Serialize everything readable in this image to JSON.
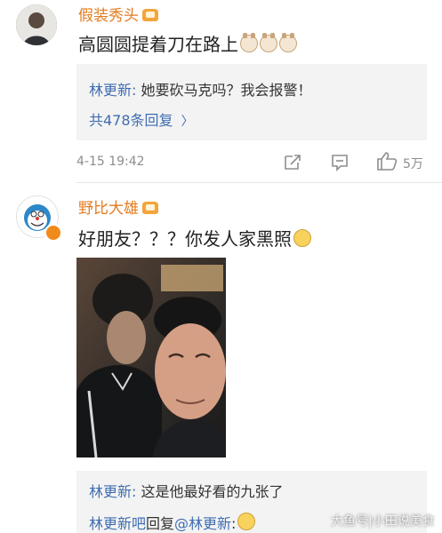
{
  "comment1": {
    "username": "假装秀头",
    "text": "高圆圆提着刀在路上",
    "reply": {
      "author": "林更新:",
      "text": " 她要砍马克吗？我会报警！"
    },
    "more_replies": "共478条回复",
    "more_chevron": "〉",
    "timestamp": "4-15 19:42",
    "likes": "5万"
  },
  "comment2": {
    "username": "野比大雄",
    "text": "好朋友？？？你发人家黑照",
    "reply1": {
      "author": "林更新:",
      "text": " 这是他最好看的九张了"
    },
    "reply2": {
      "author": "林更新吧",
      "middle": "回复",
      "mention": "@林更新",
      "tail": ":"
    }
  },
  "watermark": "大鱼号|小田说美食"
}
